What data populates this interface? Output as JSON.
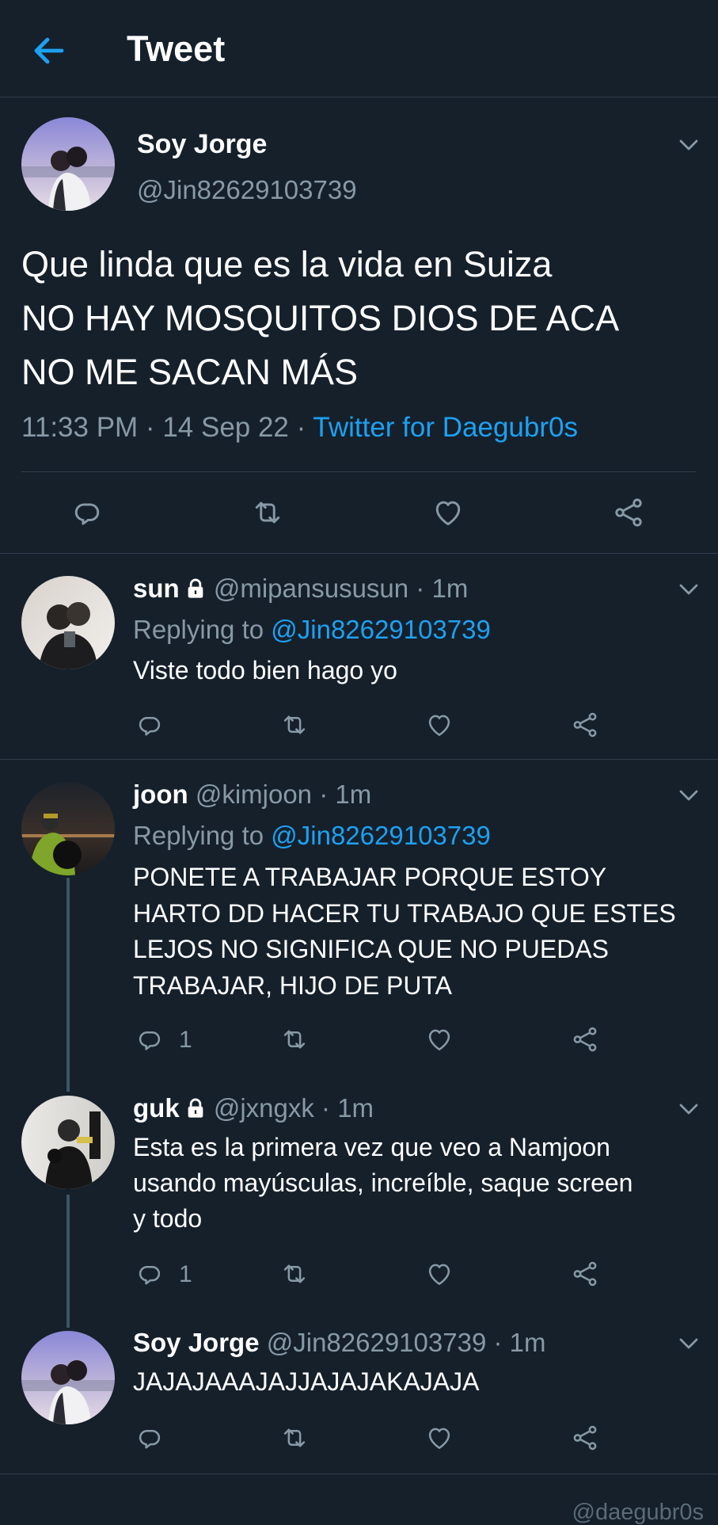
{
  "header": {
    "title": "Tweet"
  },
  "main_tweet": {
    "name": "Soy Jorge",
    "handle": "@Jin82629103739",
    "text_lines": [
      "Que linda que es la vida en Suiza",
      "NO HAY MOSQUITOS DIOS DE ACA",
      "NO ME SACAN MÁS"
    ],
    "time": "11:33 PM · 14 Sep 22 · ",
    "source": "Twitter for Daegubr0s"
  },
  "replies": [
    {
      "name": "sun",
      "handle": "@mipansususun · 1m",
      "replying_prefix": "Replying to ",
      "replying_to": "@Jin82629103739",
      "text": "Viste todo bien hago yo",
      "reply_count": ""
    },
    {
      "name": "joon",
      "handle": "@kimjoon · 1m",
      "replying_prefix": "Replying to ",
      "replying_to": "@Jin82629103739",
      "text_lines": [
        "PONETE A TRABAJAR PORQUE ESTOY",
        "HARTO DD HACER TU TRABAJO QUE ESTES",
        "LEJOS NO SIGNIFICA QUE NO PUEDAS",
        "TRABAJAR, HIJO DE PUTA"
      ],
      "reply_count": "1"
    },
    {
      "name": "guk",
      "handle": "@jxngxk · 1m",
      "text_lines": [
        "Esta es la primera vez que veo a Namjoon",
        "usando mayúsculas, increíble, saque screen",
        "y todo"
      ],
      "reply_count": "1"
    },
    {
      "name": "Soy Jorge",
      "handle": "@Jin82629103739 · 1m",
      "text": "JAJAJAAAJAJJAJAJAKAJAJA",
      "reply_count": ""
    }
  ],
  "watermark": "@daegubr0s",
  "colors": {
    "background": "#15202b",
    "accent": "#1da1f2",
    "muted": "#8899a6",
    "divider": "#2f3d4a"
  },
  "icons": [
    "back-arrow-icon",
    "chevron-down-icon",
    "comment-icon",
    "retweet-icon",
    "like-icon",
    "share-icon",
    "lock-icon"
  ]
}
